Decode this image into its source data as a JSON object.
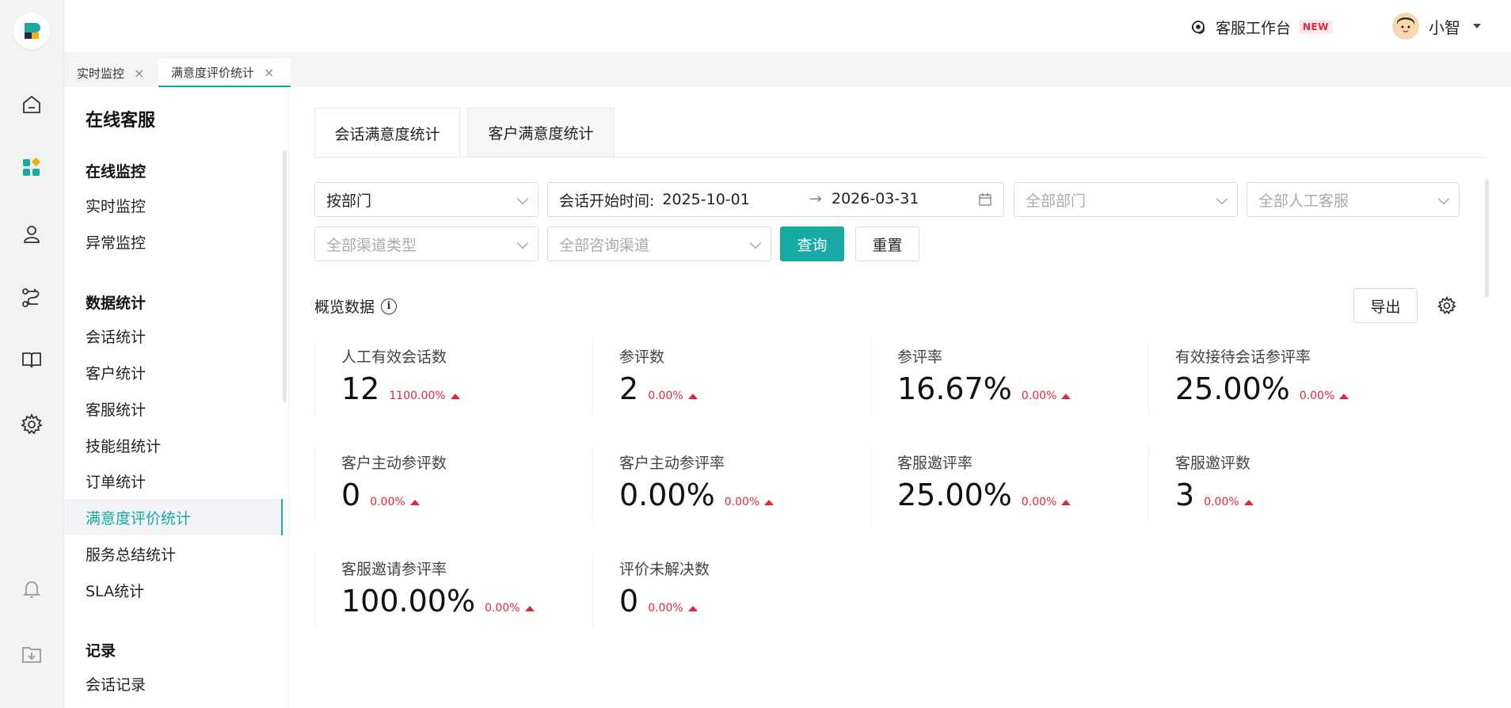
{
  "header": {
    "workspace_label": "客服工作台",
    "new_badge": "NEW",
    "user_name": "小智"
  },
  "page_tabs": [
    {
      "label": "实时监控",
      "close": "×"
    },
    {
      "label": "满意度评价统计",
      "close": "×"
    }
  ],
  "sidebar": {
    "title": "在线客服",
    "groups": [
      {
        "title": "在线监控",
        "items": [
          "实时监控",
          "异常监控"
        ]
      },
      {
        "title": "数据统计",
        "items": [
          "会话统计",
          "客户统计",
          "客服统计",
          "技能组统计",
          "订单统计",
          "满意度评价统计",
          "服务总结统计",
          "SLA统计"
        ]
      },
      {
        "title": "记录",
        "items": [
          "会话记录"
        ]
      }
    ],
    "active_item": "满意度评价统计"
  },
  "content_tabs": [
    "会话满意度统计",
    "客户满意度统计"
  ],
  "filters": {
    "group_by": "按部门",
    "date_label": "会话开始时间:",
    "date_start": "2025-10-01",
    "date_arrow": "→",
    "date_end": "2026-03-31",
    "department_placeholder": "全部部门",
    "agent_placeholder": "全部人工客服",
    "channel_type_placeholder": "全部渠道类型",
    "consult_channel_placeholder": "全部咨询渠道",
    "query_label": "查询",
    "reset_label": "重置"
  },
  "overview": {
    "title": "概览数据",
    "info_glyph": "i",
    "export_label": "导出",
    "metrics": [
      {
        "label": "人工有效会话数",
        "value": "12",
        "delta": "1100.00%"
      },
      {
        "label": "参评数",
        "value": "2",
        "delta": "0.00%"
      },
      {
        "label": "参评率",
        "value": "16.67%",
        "delta": "0.00%"
      },
      {
        "label": "有效接待会话参评率",
        "value": "25.00%",
        "delta": "0.00%"
      },
      {
        "label": "客户主动参评数",
        "value": "0",
        "delta": "0.00%"
      },
      {
        "label": "客户主动参评率",
        "value": "0.00%",
        "delta": "0.00%"
      },
      {
        "label": "客服邀评率",
        "value": "25.00%",
        "delta": "0.00%"
      },
      {
        "label": "客服邀评数",
        "value": "3",
        "delta": "0.00%"
      },
      {
        "label": "客服邀请参评率",
        "value": "100.00%",
        "delta": "0.00%"
      },
      {
        "label": "评价未解决数",
        "value": "0",
        "delta": "0.00%"
      }
    ]
  },
  "colors": {
    "accent": "#17a9a4",
    "up": "#e0283a"
  }
}
